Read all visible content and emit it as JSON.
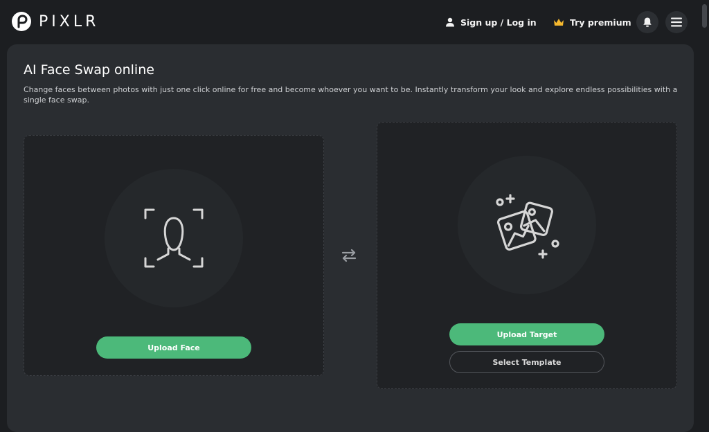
{
  "header": {
    "logo_text": "PIXLR",
    "signup_label": "Sign up / Log in",
    "premium_label": "Try premium",
    "icons": {
      "logo": "pixlr-logo-icon",
      "user": "user-icon",
      "crown": "crown-icon",
      "bell": "bell-icon",
      "menu": "hamburger-menu-icon"
    }
  },
  "main": {
    "title": "AI Face Swap online",
    "description": "Change faces between photos with just one click online for free and become whoever you want to be. Instantly transform your look and explore endless possibilities with a single face swap.",
    "face_panel": {
      "button_label": "Upload Face",
      "icon": "face-scan-icon"
    },
    "target_panel": {
      "upload_label": "Upload Target",
      "template_label": "Select Template",
      "icon": "images-icon"
    },
    "swap_icon": "swap-arrows-icon"
  },
  "colors": {
    "accent": "#4cb97a",
    "crown": "#f5b82e",
    "background": "#1c1e21",
    "panel": "#2a2d31"
  }
}
